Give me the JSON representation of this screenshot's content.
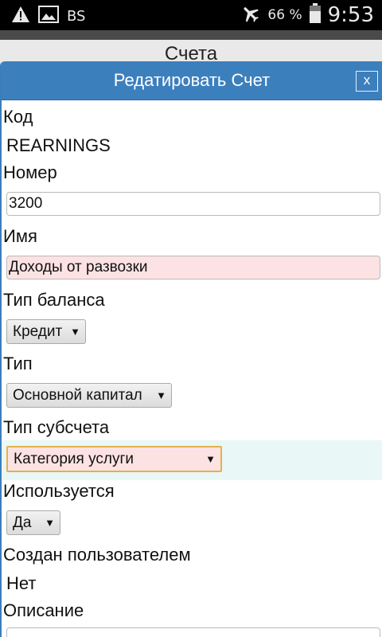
{
  "status_bar": {
    "carrier": "BS",
    "battery_percent": "66 %",
    "time": "9:53",
    "icons": [
      "warning-icon",
      "image-icon",
      "airplane-icon",
      "battery-icon"
    ]
  },
  "page": {
    "title": "Счета"
  },
  "dialog": {
    "title": "Редатировать Счет",
    "close_label": "x",
    "fields": {
      "code": {
        "label": "Код",
        "value": "REARNINGS"
      },
      "number": {
        "label": "Номер",
        "value": "3200"
      },
      "name": {
        "label": "Имя",
        "value": "Доходы от развозки"
      },
      "balance_type": {
        "label": "Тип баланса",
        "value": "Кредит"
      },
      "type": {
        "label": "Тип",
        "value": "Основной капитал"
      },
      "subaccount_type": {
        "label": "Тип субсчета",
        "value": "Категория услуги"
      },
      "in_use": {
        "label": "Используется",
        "value": "Да"
      },
      "user_created": {
        "label": "Создан пользователем",
        "value": "Нет"
      },
      "description": {
        "label": "Описание",
        "value": ""
      }
    }
  },
  "colors": {
    "dialog_header": "#3c7fbd",
    "invalid_field": "#fde2e4",
    "focus_border": "#e4b14b",
    "row_highlight": "#e9f7f7"
  }
}
